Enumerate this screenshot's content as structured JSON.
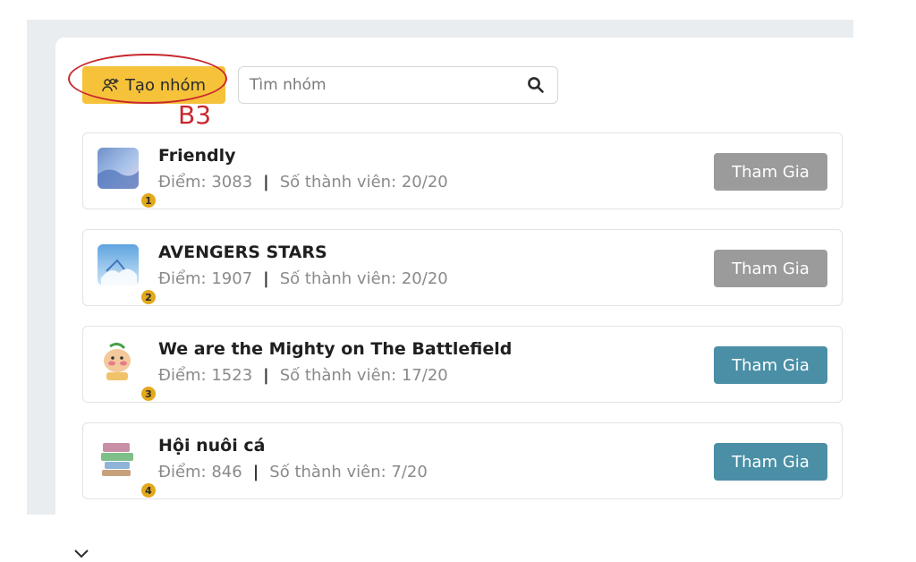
{
  "toolbar": {
    "create_group_label": "Tạo nhóm",
    "search_placeholder": "Tìm nhóm",
    "search_value": ""
  },
  "annotation": {
    "label": "B3",
    "color": "#c8282e"
  },
  "colors": {
    "create_button": "#f5c23a",
    "join_active": "#4a8fa6",
    "join_disabled": "#9b9b9b",
    "rank_badge": "#e2a91b"
  },
  "groups": [
    {
      "rank": "1",
      "name": "Friendly",
      "points_text": "Điểm: 3083",
      "members_text": "Số thành viên: 20/20",
      "join_label": "Tham Gia",
      "join_state": "disabled",
      "avatar_icon": "sky-photo-icon"
    },
    {
      "rank": "2",
      "name": "AVENGERS STARS",
      "points_text": "Điểm: 1907",
      "members_text": "Số thành viên: 20/20",
      "join_label": "Tham Gia",
      "join_state": "disabled",
      "avatar_icon": "sky-photo-icon"
    },
    {
      "rank": "3",
      "name": "We are the Mighty on The Battlefield",
      "points_text": "Điểm: 1523",
      "members_text": "Số thành viên: 17/20",
      "join_label": "Tham Gia",
      "join_state": "active",
      "avatar_icon": "cartoon-character-icon"
    },
    {
      "rank": "4",
      "name": "Hội nuôi cá",
      "points_text": "Điểm: 846",
      "members_text": "Số thành viên: 7/20",
      "join_label": "Tham Gia",
      "join_state": "active",
      "avatar_icon": "sticker-collage-icon"
    }
  ]
}
